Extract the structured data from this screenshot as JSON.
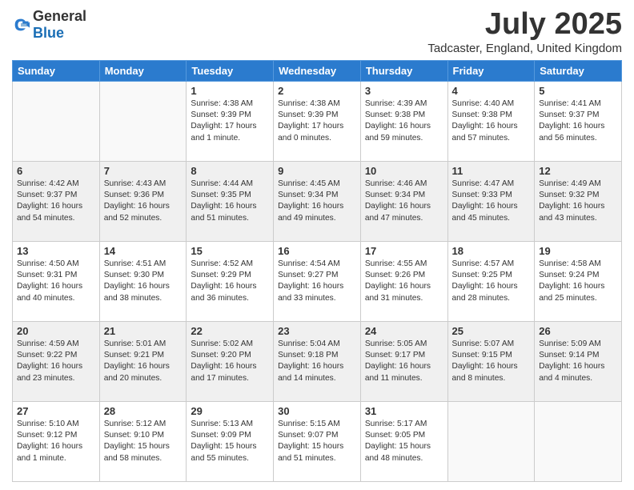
{
  "logo": {
    "general": "General",
    "blue": "Blue"
  },
  "header": {
    "title": "July 2025",
    "subtitle": "Tadcaster, England, United Kingdom"
  },
  "weekdays": [
    "Sunday",
    "Monday",
    "Tuesday",
    "Wednesday",
    "Thursday",
    "Friday",
    "Saturday"
  ],
  "weeks": [
    [
      {
        "day": null
      },
      {
        "day": null
      },
      {
        "day": 1,
        "sunrise": "Sunrise: 4:38 AM",
        "sunset": "Sunset: 9:39 PM",
        "daylight": "Daylight: 17 hours and 1 minute."
      },
      {
        "day": 2,
        "sunrise": "Sunrise: 4:38 AM",
        "sunset": "Sunset: 9:39 PM",
        "daylight": "Daylight: 17 hours and 0 minutes."
      },
      {
        "day": 3,
        "sunrise": "Sunrise: 4:39 AM",
        "sunset": "Sunset: 9:38 PM",
        "daylight": "Daylight: 16 hours and 59 minutes."
      },
      {
        "day": 4,
        "sunrise": "Sunrise: 4:40 AM",
        "sunset": "Sunset: 9:38 PM",
        "daylight": "Daylight: 16 hours and 57 minutes."
      },
      {
        "day": 5,
        "sunrise": "Sunrise: 4:41 AM",
        "sunset": "Sunset: 9:37 PM",
        "daylight": "Daylight: 16 hours and 56 minutes."
      }
    ],
    [
      {
        "day": 6,
        "sunrise": "Sunrise: 4:42 AM",
        "sunset": "Sunset: 9:37 PM",
        "daylight": "Daylight: 16 hours and 54 minutes."
      },
      {
        "day": 7,
        "sunrise": "Sunrise: 4:43 AM",
        "sunset": "Sunset: 9:36 PM",
        "daylight": "Daylight: 16 hours and 52 minutes."
      },
      {
        "day": 8,
        "sunrise": "Sunrise: 4:44 AM",
        "sunset": "Sunset: 9:35 PM",
        "daylight": "Daylight: 16 hours and 51 minutes."
      },
      {
        "day": 9,
        "sunrise": "Sunrise: 4:45 AM",
        "sunset": "Sunset: 9:34 PM",
        "daylight": "Daylight: 16 hours and 49 minutes."
      },
      {
        "day": 10,
        "sunrise": "Sunrise: 4:46 AM",
        "sunset": "Sunset: 9:34 PM",
        "daylight": "Daylight: 16 hours and 47 minutes."
      },
      {
        "day": 11,
        "sunrise": "Sunrise: 4:47 AM",
        "sunset": "Sunset: 9:33 PM",
        "daylight": "Daylight: 16 hours and 45 minutes."
      },
      {
        "day": 12,
        "sunrise": "Sunrise: 4:49 AM",
        "sunset": "Sunset: 9:32 PM",
        "daylight": "Daylight: 16 hours and 43 minutes."
      }
    ],
    [
      {
        "day": 13,
        "sunrise": "Sunrise: 4:50 AM",
        "sunset": "Sunset: 9:31 PM",
        "daylight": "Daylight: 16 hours and 40 minutes."
      },
      {
        "day": 14,
        "sunrise": "Sunrise: 4:51 AM",
        "sunset": "Sunset: 9:30 PM",
        "daylight": "Daylight: 16 hours and 38 minutes."
      },
      {
        "day": 15,
        "sunrise": "Sunrise: 4:52 AM",
        "sunset": "Sunset: 9:29 PM",
        "daylight": "Daylight: 16 hours and 36 minutes."
      },
      {
        "day": 16,
        "sunrise": "Sunrise: 4:54 AM",
        "sunset": "Sunset: 9:27 PM",
        "daylight": "Daylight: 16 hours and 33 minutes."
      },
      {
        "day": 17,
        "sunrise": "Sunrise: 4:55 AM",
        "sunset": "Sunset: 9:26 PM",
        "daylight": "Daylight: 16 hours and 31 minutes."
      },
      {
        "day": 18,
        "sunrise": "Sunrise: 4:57 AM",
        "sunset": "Sunset: 9:25 PM",
        "daylight": "Daylight: 16 hours and 28 minutes."
      },
      {
        "day": 19,
        "sunrise": "Sunrise: 4:58 AM",
        "sunset": "Sunset: 9:24 PM",
        "daylight": "Daylight: 16 hours and 25 minutes."
      }
    ],
    [
      {
        "day": 20,
        "sunrise": "Sunrise: 4:59 AM",
        "sunset": "Sunset: 9:22 PM",
        "daylight": "Daylight: 16 hours and 23 minutes."
      },
      {
        "day": 21,
        "sunrise": "Sunrise: 5:01 AM",
        "sunset": "Sunset: 9:21 PM",
        "daylight": "Daylight: 16 hours and 20 minutes."
      },
      {
        "day": 22,
        "sunrise": "Sunrise: 5:02 AM",
        "sunset": "Sunset: 9:20 PM",
        "daylight": "Daylight: 16 hours and 17 minutes."
      },
      {
        "day": 23,
        "sunrise": "Sunrise: 5:04 AM",
        "sunset": "Sunset: 9:18 PM",
        "daylight": "Daylight: 16 hours and 14 minutes."
      },
      {
        "day": 24,
        "sunrise": "Sunrise: 5:05 AM",
        "sunset": "Sunset: 9:17 PM",
        "daylight": "Daylight: 16 hours and 11 minutes."
      },
      {
        "day": 25,
        "sunrise": "Sunrise: 5:07 AM",
        "sunset": "Sunset: 9:15 PM",
        "daylight": "Daylight: 16 hours and 8 minutes."
      },
      {
        "day": 26,
        "sunrise": "Sunrise: 5:09 AM",
        "sunset": "Sunset: 9:14 PM",
        "daylight": "Daylight: 16 hours and 4 minutes."
      }
    ],
    [
      {
        "day": 27,
        "sunrise": "Sunrise: 5:10 AM",
        "sunset": "Sunset: 9:12 PM",
        "daylight": "Daylight: 16 hours and 1 minute."
      },
      {
        "day": 28,
        "sunrise": "Sunrise: 5:12 AM",
        "sunset": "Sunset: 9:10 PM",
        "daylight": "Daylight: 15 hours and 58 minutes."
      },
      {
        "day": 29,
        "sunrise": "Sunrise: 5:13 AM",
        "sunset": "Sunset: 9:09 PM",
        "daylight": "Daylight: 15 hours and 55 minutes."
      },
      {
        "day": 30,
        "sunrise": "Sunrise: 5:15 AM",
        "sunset": "Sunset: 9:07 PM",
        "daylight": "Daylight: 15 hours and 51 minutes."
      },
      {
        "day": 31,
        "sunrise": "Sunrise: 5:17 AM",
        "sunset": "Sunset: 9:05 PM",
        "daylight": "Daylight: 15 hours and 48 minutes."
      },
      {
        "day": null
      },
      {
        "day": null
      }
    ]
  ]
}
